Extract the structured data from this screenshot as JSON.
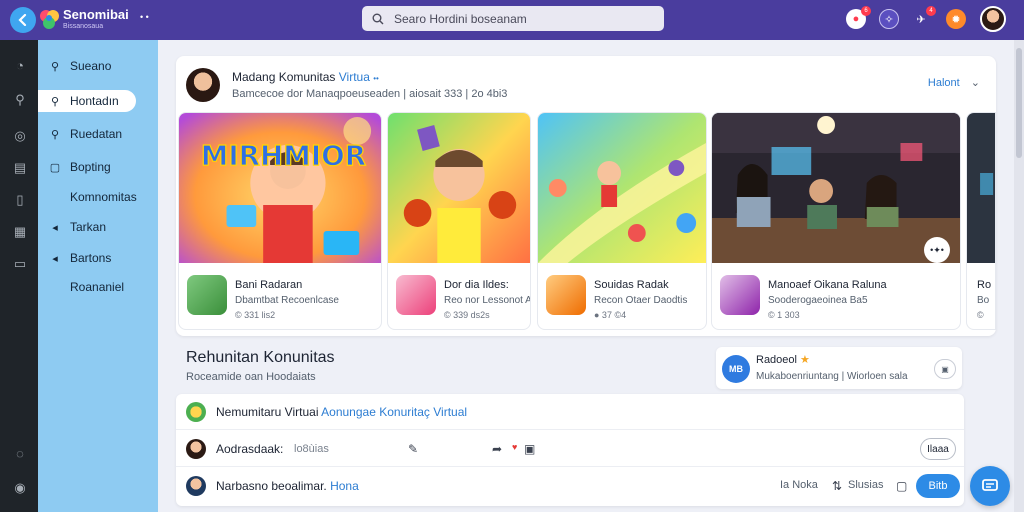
{
  "app": {
    "title": "Senomibai",
    "subtitle": "Bissanosaua",
    "dots": "• •"
  },
  "search": {
    "placeholder": "Searo Hordini boseanam"
  },
  "topbar": {
    "notifications_badge": "6",
    "messages_badge": "4",
    "icons": [
      "notification-icon",
      "compass-icon",
      "rocket-icon",
      "reward-icon",
      "profile-avatar"
    ]
  },
  "sidebar": {
    "items": [
      {
        "label": "Sueano",
        "icon": "search-icon"
      },
      {
        "label": "Hontadın",
        "icon": "search-icon"
      },
      {
        "label": "Ruedatan",
        "icon": "search-icon"
      },
      {
        "label": "Bopting",
        "icon": "square-icon"
      },
      {
        "label": "Komnomitas",
        "icon": ""
      },
      {
        "label": "Tarkan",
        "icon": "chevron-icon"
      },
      {
        "label": "Bartons",
        "icon": "chevron-icon"
      },
      {
        "label": "Roananiel",
        "icon": ""
      }
    ]
  },
  "main": {
    "title": "Madang Komunitas",
    "title_highlight": "Virtua",
    "title_dots": "••",
    "subtitle": "Bamcecoe dor Manaqpoeuseaden | aiosait 333 | 2o 4bi3",
    "action_label": "Halont",
    "tiles": [
      {
        "name": "Bani Radaran",
        "sub": "Dbamtbat Recoenlcase",
        "meta": "© 331 lis2",
        "banner": "MIRHMIOR"
      },
      {
        "name": "Dor dia Ildes:",
        "sub": "Reo nor Lessonot Aeatt",
        "meta": "© 339 ds2s",
        "banner": ""
      },
      {
        "name": "Souidas Radak",
        "sub": "Recon Otaer Daodtis",
        "meta": "● 37 ©4",
        "banner": ""
      },
      {
        "name": "Manoaef Oikana Raluna",
        "sub": "Sooderogaeoinea Ba5",
        "meta": "© 1 303",
        "banner": ""
      },
      {
        "name": "Ro",
        "sub": "Bo",
        "meta": "©",
        "banner": ""
      }
    ]
  },
  "community": {
    "title": "Rehunitan Konunitas",
    "subtitle": "Roceamide oan Hoodaiats",
    "card": {
      "name": "Radoeol",
      "description": "Mukaboenriuntang | Wiorloen sala",
      "avatar_text": "MB"
    },
    "rows": [
      {
        "text": "Nemumitaru Virtuai",
        "highlight": "Aonungae Konuritaç Virtual"
      },
      {
        "text": "Aodrasdaak:",
        "placeholder": "lo8ùias",
        "button_label": "Ilaaa"
      },
      {
        "text": "Narbasno beoalimar.",
        "highlight": "Hona",
        "mini1": "Ia Noka",
        "mini2": "Slusias",
        "primary_label": "Bitb"
      }
    ]
  },
  "colors": {
    "topbar": "#4a3d9e",
    "sidebar": "#8ecbf2",
    "accent": "#2d8be6",
    "rail": "#1f2429"
  }
}
